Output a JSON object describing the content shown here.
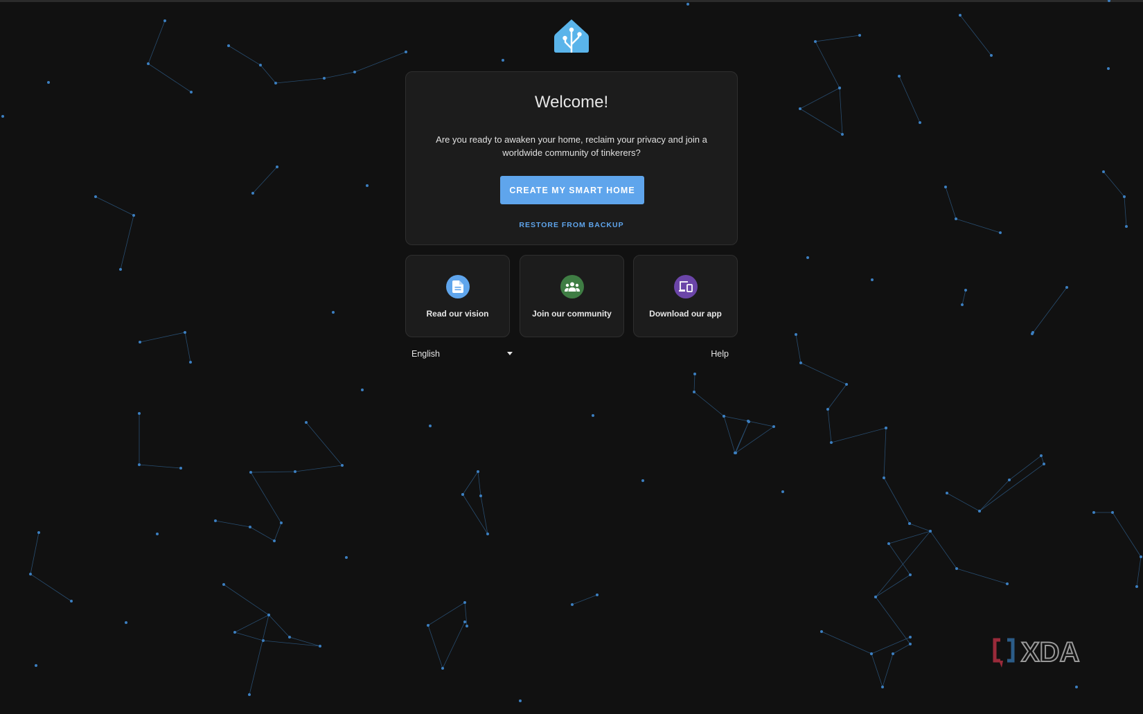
{
  "welcome": {
    "title": "Welcome!",
    "message": "Are you ready to awaken your home, reclaim your privacy and join a worldwide community of tinkerers?",
    "create_button": "CREATE MY SMART HOME",
    "restore_button": "RESTORE FROM BACKUP"
  },
  "links": [
    {
      "label": "Read our vision",
      "icon": "document-icon",
      "color": "#5fa5ec"
    },
    {
      "label": "Join our community",
      "icon": "group-icon",
      "color": "#3f7d44"
    },
    {
      "label": "Download our app",
      "icon": "devices-icon",
      "color": "#6b45a8"
    }
  ],
  "footer": {
    "language": "English",
    "help": "Help"
  },
  "watermark": {
    "text": "XDA"
  },
  "colors": {
    "accent": "#5fa5ec",
    "background": "#111111",
    "card": "#1c1c1c",
    "constellation": "#3c7fc0"
  }
}
